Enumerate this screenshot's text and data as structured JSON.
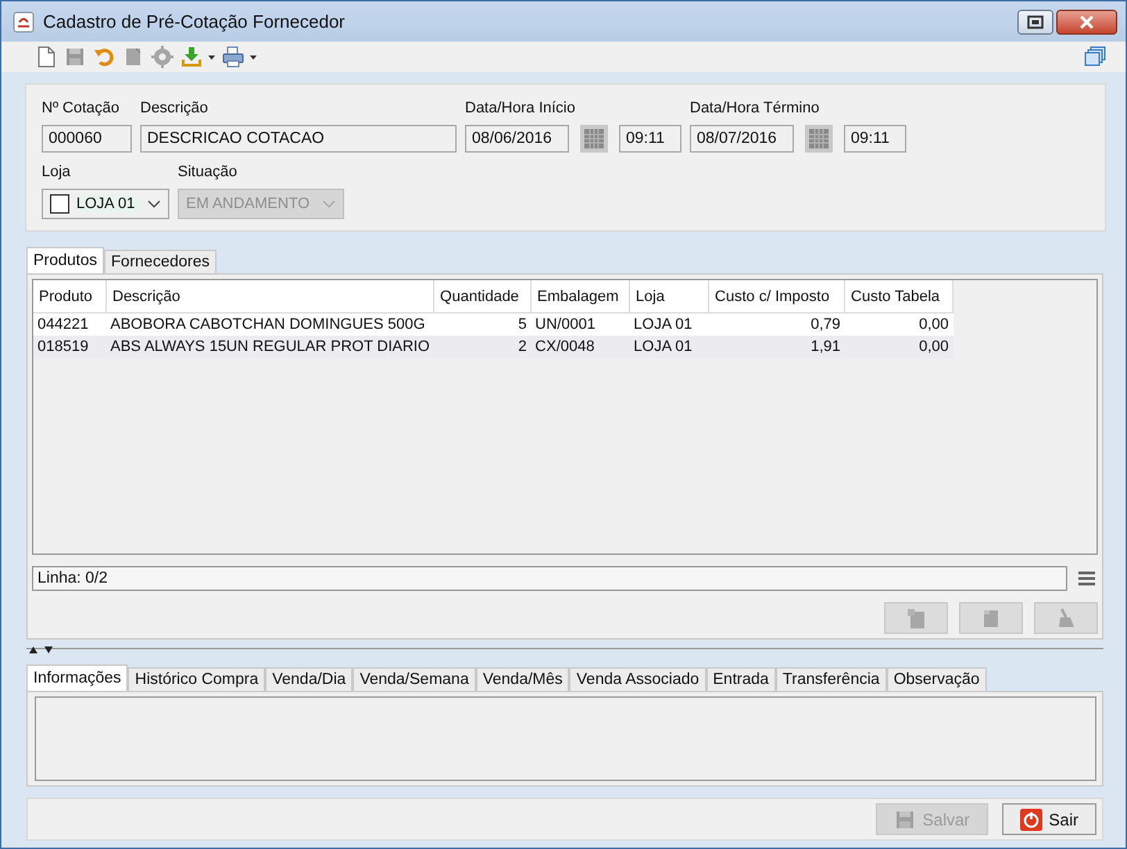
{
  "window": {
    "title": "Cadastro de Pré-Cotação Fornecedor"
  },
  "toolbar": [
    {
      "kind": "new",
      "disabled": false
    },
    {
      "kind": "save",
      "disabled": true
    },
    {
      "kind": "undo",
      "disabled": false
    },
    {
      "kind": "edit",
      "disabled": true
    },
    {
      "kind": "gear",
      "disabled": true
    },
    {
      "kind": "download",
      "disabled": false,
      "menu": true
    },
    {
      "kind": "print",
      "disabled": false,
      "menu": true
    }
  ],
  "form": {
    "fields": [
      {
        "kind": "text",
        "label": "Nº Cotação",
        "value": "000060"
      },
      {
        "kind": "text",
        "label": "Descrição",
        "value": "DESCRICAO COTACAO"
      },
      {
        "kind": "datetime",
        "label": "Data/Hora Início",
        "date": "08/06/2016",
        "time": "09:11"
      },
      {
        "kind": "datetime",
        "label": "Data/Hora Término",
        "date": "08/07/2016",
        "time": "09:11"
      }
    ],
    "selects": [
      {
        "label": "Loja",
        "value": "LOJA 01",
        "checkbox": true,
        "checked": false,
        "disabled": false
      },
      {
        "label": "Situação",
        "value": "EM ANDAMENTO",
        "checkbox": false,
        "disabled": true
      }
    ]
  },
  "tabs": [
    {
      "label": "Produtos",
      "selected": true
    },
    {
      "label": "Fornecedores",
      "selected": false
    }
  ],
  "table": {
    "columns": [
      {
        "label": "Produto",
        "kind": "text"
      },
      {
        "label": "Descrição",
        "kind": "text"
      },
      {
        "label": "Quantidade",
        "kind": "number"
      },
      {
        "label": "Embalagem",
        "kind": "text"
      },
      {
        "label": "Loja",
        "kind": "text"
      },
      {
        "label": "Custo c/ Imposto",
        "kind": "number"
      },
      {
        "label": "Custo Tabela",
        "kind": "number"
      }
    ],
    "rows": [
      [
        "044221",
        "ABOBORA CABOTCHAN DOMINGUES 500G",
        "5",
        "UN/0001",
        "LOJA 01",
        "0,79",
        "0,00"
      ],
      [
        "018519",
        "ABS ALWAYS 15UN REGULAR PROT DIARIO",
        "2",
        "CX/0048",
        "LOJA 01",
        "1,91",
        "0,00"
      ]
    ]
  },
  "status": "Linha: 0/2",
  "row_actions": [
    {
      "kind": "add",
      "disabled": true
    },
    {
      "kind": "remove",
      "disabled": true
    },
    {
      "kind": "clear",
      "disabled": true
    }
  ],
  "bottom_tabs": [
    {
      "label": "Informações",
      "selected": true
    },
    {
      "label": "Histórico Compra",
      "selected": false
    },
    {
      "label": "Venda/Dia",
      "selected": false
    },
    {
      "label": "Venda/Semana",
      "selected": false
    },
    {
      "label": "Venda/Mês",
      "selected": false
    },
    {
      "label": "Venda Associado",
      "selected": false
    },
    {
      "label": "Entrada",
      "selected": false
    },
    {
      "label": "Transferência",
      "selected": false
    },
    {
      "label": "Observação",
      "selected": false
    }
  ],
  "buttons": [
    {
      "kind": "save",
      "label": "Salvar",
      "disabled": true
    },
    {
      "kind": "exit",
      "label": "Sair",
      "disabled": false
    }
  ]
}
